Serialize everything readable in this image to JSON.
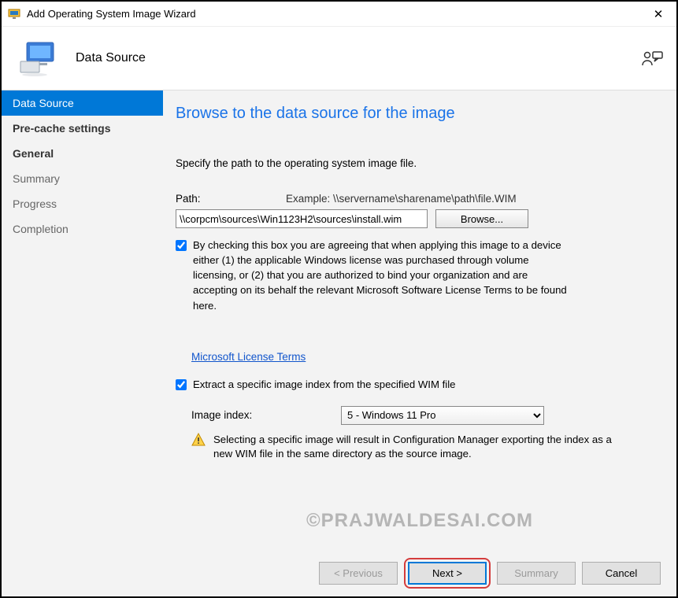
{
  "titlebar": {
    "title": "Add Operating System Image Wizard"
  },
  "header": {
    "subtitle": "Data Source"
  },
  "sidebar": {
    "steps": [
      {
        "label": "Data Source",
        "state": "active"
      },
      {
        "label": "Pre-cache settings",
        "state": "bold"
      },
      {
        "label": "General",
        "state": "bold"
      },
      {
        "label": "Summary",
        "state": "muted"
      },
      {
        "label": "Progress",
        "state": "muted"
      },
      {
        "label": "Completion",
        "state": "muted"
      }
    ]
  },
  "main": {
    "heading": "Browse to the data source for the image",
    "instruction": "Specify the path to the operating system image file.",
    "path_label": "Path:",
    "example_label": "Example: \\\\servername\\sharename\\path\\file.WIM",
    "path_value": "\\\\corpcm\\sources\\Win1123H2\\sources\\install.wim",
    "browse_button": "Browse...",
    "agree_checked": true,
    "agree_text": "By checking this box you are agreeing that when applying this image to a device either (1) the applicable Windows license was purchased through volume licensing, or (2) that you are authorized to bind your organization and are accepting on its behalf the relevant Microsoft Software License Terms to be found here.",
    "license_link": "Microsoft License Terms",
    "extract_checked": true,
    "extract_text": "Extract a specific image index from the specified WIM file",
    "index_label": "Image index:",
    "index_value": "5 - Windows 11 Pro",
    "warn_text": "Selecting a specific image will result in Configuration Manager exporting the index as a new WIM file in the same directory as the source image."
  },
  "footer": {
    "previous": "< Previous",
    "next": "Next >",
    "summary": "Summary",
    "cancel": "Cancel"
  },
  "watermark": "©PRAJWALDESAI.COM"
}
